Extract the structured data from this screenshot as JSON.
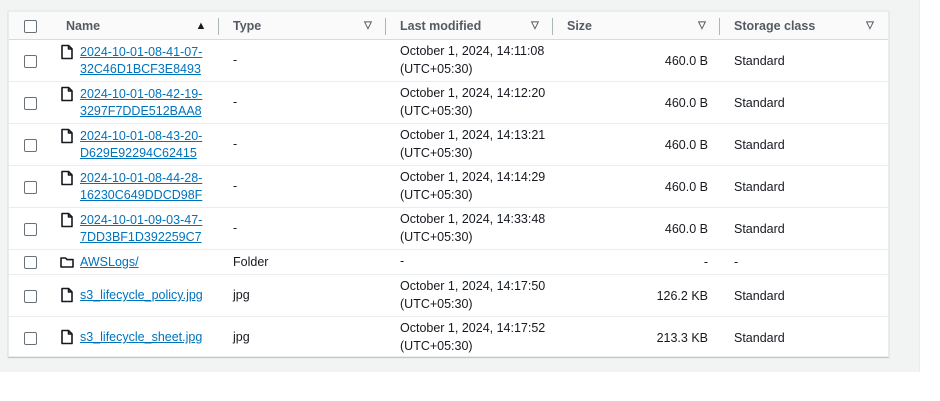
{
  "columns": {
    "name": "Name",
    "type": "Type",
    "last_modified": "Last modified",
    "size": "Size",
    "storage_class": "Storage class"
  },
  "icons": {
    "sort_ascending": "caret-up-filled-icon",
    "sort_descending": "caret-down-icon",
    "file": "file-icon",
    "folder": "folder-icon"
  },
  "colors": {
    "link": "#0073bb",
    "header_bg": "#fafafa"
  },
  "rows": [
    {
      "kind": "file",
      "name_line1": "2024-10-01-08-41-07-",
      "name_line2": "32C46D1BCF3E8493",
      "type": "-",
      "modified_line1": "October 1, 2024, 14:11:08",
      "modified_line2": "(UTC+05:30)",
      "size": "460.0 B",
      "storage_class": "Standard"
    },
    {
      "kind": "file",
      "name_line1": "2024-10-01-08-42-19-",
      "name_line2": "3297F7DDE512BAA8",
      "type": "-",
      "modified_line1": "October 1, 2024, 14:12:20",
      "modified_line2": "(UTC+05:30)",
      "size": "460.0 B",
      "storage_class": "Standard"
    },
    {
      "kind": "file",
      "name_line1": "2024-10-01-08-43-20-",
      "name_line2": "D629E92294C62415",
      "type": "-",
      "modified_line1": "October 1, 2024, 14:13:21",
      "modified_line2": "(UTC+05:30)",
      "size": "460.0 B",
      "storage_class": "Standard"
    },
    {
      "kind": "file",
      "name_line1": "2024-10-01-08-44-28-",
      "name_line2": "16230C649DDCD98F",
      "type": "-",
      "modified_line1": "October 1, 2024, 14:14:29",
      "modified_line2": "(UTC+05:30)",
      "size": "460.0 B",
      "storage_class": "Standard"
    },
    {
      "kind": "file",
      "name_line1": "2024-10-01-09-03-47-",
      "name_line2": "7DD3BF1D392259C7",
      "type": "-",
      "modified_line1": "October 1, 2024, 14:33:48",
      "modified_line2": "(UTC+05:30)",
      "size": "460.0 B",
      "storage_class": "Standard"
    },
    {
      "kind": "folder",
      "name_line1": "AWSLogs/",
      "name_line2": "",
      "type": "Folder",
      "modified_line1": "-",
      "modified_line2": "",
      "size": "-",
      "storage_class": "-"
    },
    {
      "kind": "file",
      "name_line1": "s3_lifecycle_policy.jpg",
      "name_line2": "",
      "type": "jpg",
      "modified_line1": "October 1, 2024, 14:17:50",
      "modified_line2": "(UTC+05:30)",
      "size": "126.2 KB",
      "storage_class": "Standard"
    },
    {
      "kind": "file",
      "name_line1": "s3_lifecycle_sheet.jpg",
      "name_line2": "",
      "type": "jpg",
      "modified_line1": "October 1, 2024, 14:17:52",
      "modified_line2": "(UTC+05:30)",
      "size": "213.3 KB",
      "storage_class": "Standard"
    }
  ]
}
